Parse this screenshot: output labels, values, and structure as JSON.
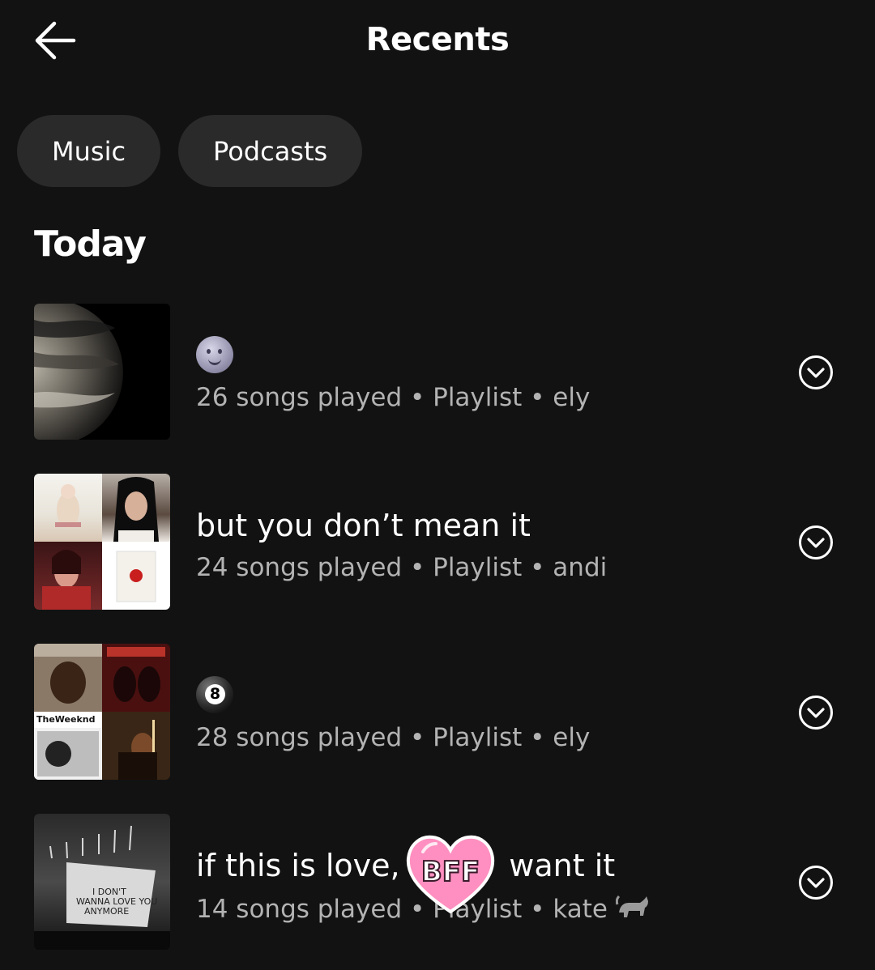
{
  "header": {
    "title": "Recents",
    "back_icon": "arrow-left-icon"
  },
  "filters": [
    {
      "label": "Music"
    },
    {
      "label": "Podcasts"
    }
  ],
  "section": {
    "title": "Today"
  },
  "items": [
    {
      "title": "",
      "title_icon": "moon-face-emoji",
      "subtitle": "26 songs played • Playlist • ely",
      "cover": "planet-cover"
    },
    {
      "title": "but you don’t mean it",
      "subtitle": "24 songs played • Playlist • andi",
      "cover": "mosaic-cover"
    },
    {
      "title": "",
      "title_icon": "eight-ball-emoji",
      "subtitle": "28 songs played • Playlist • ely",
      "cover": "mosaic-cover"
    },
    {
      "title": "if this is love, i",
      "title_end": "want it",
      "subtitle": "14 songs played •",
      "subtitle_end": "Playlist • kate",
      "subtitle_icon": "cat-emoji",
      "cover": "concert-cover"
    }
  ],
  "sticker": {
    "text": "BFF",
    "color": "#ff8fc0"
  },
  "colors": {
    "background": "#121212",
    "chip": "#2a2a2a",
    "subtext": "#b3b3b3"
  }
}
